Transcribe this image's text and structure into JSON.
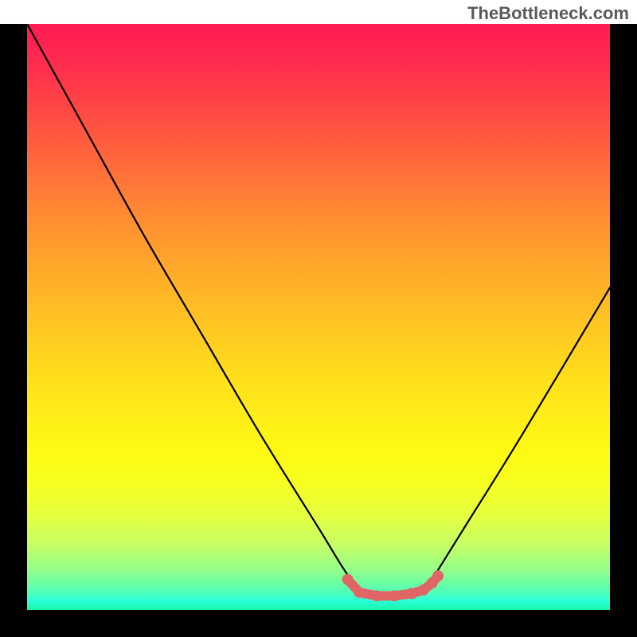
{
  "attribution": "TheBottleneck.com",
  "chart_data": {
    "type": "line",
    "title": "",
    "xlabel": "",
    "ylabel": "",
    "xlim": [
      0,
      100
    ],
    "ylim": [
      0,
      100
    ],
    "series": [
      {
        "name": "bottleneck-curve",
        "x": [
          0,
          10,
          20,
          30,
          40,
          50,
          55,
          58,
          62,
          68,
          70,
          75,
          85,
          100
        ],
        "y": [
          100,
          82,
          64,
          47,
          30,
          14,
          6,
          3,
          2,
          3,
          6,
          14,
          30,
          55
        ]
      }
    ],
    "highlight": {
      "name": "optimal-zone",
      "points": [
        {
          "x": 55,
          "y": 5.2
        },
        {
          "x": 57,
          "y": 3.0
        },
        {
          "x": 60,
          "y": 2.4
        },
        {
          "x": 63,
          "y": 2.4
        },
        {
          "x": 66,
          "y": 2.8
        },
        {
          "x": 68,
          "y": 3.4
        },
        {
          "x": 69.5,
          "y": 4.6
        },
        {
          "x": 70.5,
          "y": 5.8
        }
      ],
      "color": "#e06666"
    },
    "background_gradient": {
      "top": "#ff1a55",
      "mid": "#ffe31b",
      "bottom": "#18f8a8"
    }
  }
}
